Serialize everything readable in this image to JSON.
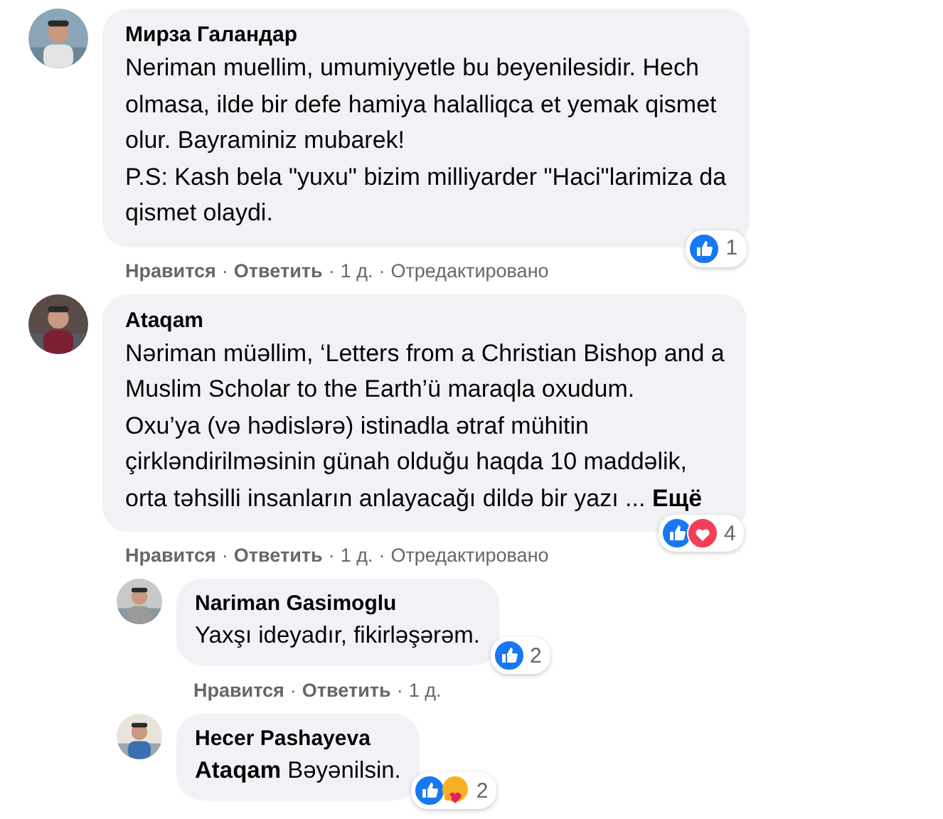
{
  "action_separator": "·",
  "comments": [
    {
      "author": "Мирза Галандар",
      "text": "Neriman muellim, umumiyyetle bu beyenilesidir. Hech\nolmasa, ilde bir defe hamiya halalliqca et yemak qismet\nolur. Bayraminiz mubarek!\nP.S: Kash bela \"yuxu\" bizim milliyarder \"Haci\"larimiza da\nqismet olaydi.",
      "reactions": {
        "icons": [
          {
            "kind": "like"
          }
        ],
        "count": "1"
      },
      "actions": [
        {
          "label": "Нравится",
          "kind": "link"
        },
        {
          "label": "Ответить",
          "kind": "link"
        },
        {
          "label": "1 д.",
          "kind": "time"
        },
        {
          "label": "Отредактировано",
          "kind": "meta"
        }
      ]
    },
    {
      "author": "Ataqam",
      "text": "Nəriman müəllim, ‘Letters from a Christian Bishop and a\nMuslim Scholar to the Earth’ü maraqla oxudum.\nOxu’ya (və hədislərə) istinadla ətraf mühitin\nçirkləndirilməsinin günah olduğu haqda 10 maddəlik,\norta təhsilli insanların anlayacağı dildə bir yazı ...",
      "more_link": "Ещё",
      "reactions": {
        "icons": [
          {
            "kind": "like"
          },
          {
            "kind": "love"
          }
        ],
        "count": "4"
      },
      "actions": [
        {
          "label": "Нравится",
          "kind": "link"
        },
        {
          "label": "Ответить",
          "kind": "link"
        },
        {
          "label": "1 д.",
          "kind": "time"
        },
        {
          "label": "Отредактировано",
          "kind": "meta"
        }
      ],
      "replies": [
        {
          "author": "Nariman Gasimoglu",
          "text": "Yaxşı ideyadır, fikirləşərəm.",
          "reactions": {
            "icons": [
              {
                "kind": "like"
              }
            ],
            "count": "2"
          },
          "actions": [
            {
              "label": "Нравится",
              "kind": "link"
            },
            {
              "label": "Ответить",
              "kind": "link"
            },
            {
              "label": "1 д.",
              "kind": "time"
            }
          ]
        },
        {
          "author": "Hecer Pashayeva",
          "text": "**Ataqam** Bəyənilsin.",
          "reactions": {
            "icons": [
              {
                "kind": "like"
              },
              {
                "kind": "care"
              }
            ],
            "count": "2"
          }
        }
      ]
    }
  ]
}
